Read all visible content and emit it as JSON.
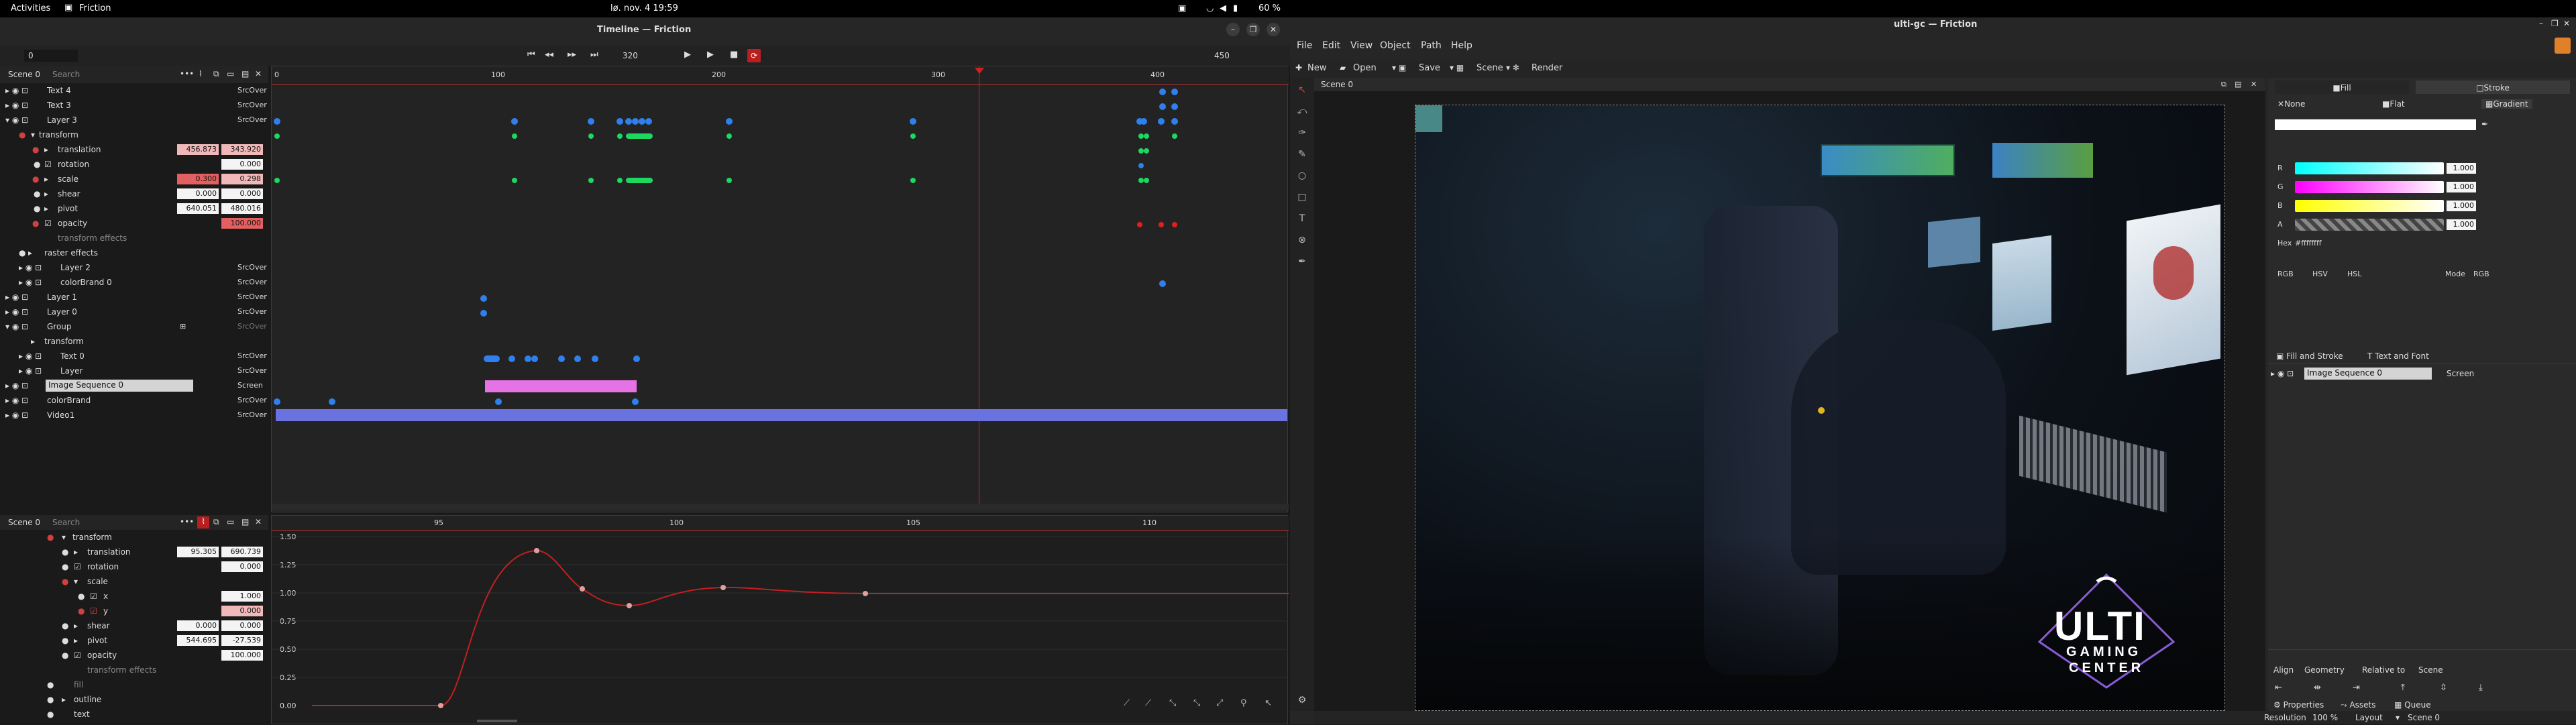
{
  "topbar": {
    "activities": "Activities",
    "app": "Friction",
    "clock": "lø. nov. 4  19:59",
    "battery": "60 %"
  },
  "timeline": {
    "title": "Timeline — Friction",
    "frame_start": "0",
    "frame_current": "320",
    "frame_end": "450",
    "scene": "Scene 0",
    "search_placeholder": "Search",
    "ruler": [
      "0",
      "100",
      "200",
      "300",
      "400"
    ],
    "layers": [
      {
        "name": "Text 4",
        "blend": "SrcOver"
      },
      {
        "name": "Text 3",
        "blend": "SrcOver"
      },
      {
        "name": "Layer 3",
        "blend": "SrcOver"
      },
      {
        "name": "transform"
      },
      {
        "name": "translation",
        "v1": "456.873",
        "v2": "343.920"
      },
      {
        "name": "rotation",
        "v1": "0.000"
      },
      {
        "name": "scale",
        "v1": "0.300",
        "v2": "0.298"
      },
      {
        "name": "shear",
        "v1": "0.000",
        "v2": "0.000"
      },
      {
        "name": "pivot",
        "v1": "640.051",
        "v2": "480.016"
      },
      {
        "name": "opacity",
        "v1": "100.000"
      },
      {
        "name": "transform effects"
      },
      {
        "name": "raster effects"
      },
      {
        "name": "Layer 2",
        "blend": "SrcOver"
      },
      {
        "name": "colorBrand 0",
        "blend": "SrcOver"
      },
      {
        "name": "Layer 1",
        "blend": "SrcOver"
      },
      {
        "name": "Layer 0",
        "blend": "SrcOver"
      },
      {
        "name": "Group",
        "blend": "SrcOver"
      },
      {
        "name": "transform"
      },
      {
        "name": "Text 0",
        "blend": "SrcOver"
      },
      {
        "name": "Layer",
        "blend": "SrcOver"
      },
      {
        "name": "Image Sequence 0",
        "blend": "Screen"
      },
      {
        "name": "colorBrand",
        "blend": "SrcOver"
      },
      {
        "name": "Video1",
        "blend": "SrcOver"
      }
    ]
  },
  "graph": {
    "scene": "Scene 0",
    "search_placeholder": "Search",
    "ruler": [
      "95",
      "100",
      "105",
      "110"
    ],
    "yticks": [
      "1.50",
      "1.25",
      "1.00",
      "0.75",
      "0.50",
      "0.25",
      "0.00"
    ],
    "props": [
      {
        "name": "transform"
      },
      {
        "name": "translation",
        "v1": "95.305",
        "v2": "690.739"
      },
      {
        "name": "rotation",
        "v1": "0.000"
      },
      {
        "name": "scale"
      },
      {
        "name": "x",
        "v1": "1.000"
      },
      {
        "name": "y",
        "v1": "0.000"
      },
      {
        "name": "shear",
        "v1": "0.000",
        "v2": "0.000"
      },
      {
        "name": "pivot",
        "v1": "544.695",
        "v2": "-27.539"
      },
      {
        "name": "opacity",
        "v1": "100.000"
      },
      {
        "name": "transform effects"
      },
      {
        "name": "fill"
      },
      {
        "name": "outline"
      },
      {
        "name": "text"
      }
    ]
  },
  "main": {
    "title": "ulti-gc — Friction",
    "menu": [
      "File",
      "Edit",
      "View",
      "Object",
      "Path",
      "Help"
    ],
    "toolbar": {
      "new": "New",
      "open": "Open",
      "save": "Save",
      "scene": "Scene",
      "render": "Render"
    },
    "scene_tab": "Scene 0",
    "logo": {
      "line1": "ULTI",
      "line2": "GAMING",
      "line3": "CENTER"
    },
    "status": {
      "resolution_label": "Resolution",
      "resolution": "100 %",
      "layout_label": "Layout",
      "layout": "Scene 0"
    }
  },
  "fill": {
    "fill_tab": "Fill",
    "stroke_tab": "Stroke",
    "none": "None",
    "flat": "Flat",
    "gradient": "Gradient",
    "channels": [
      {
        "label": "R",
        "value": "1.000"
      },
      {
        "label": "G",
        "value": "1.000"
      },
      {
        "label": "B",
        "value": "1.000"
      },
      {
        "label": "A",
        "value": "1.000"
      }
    ],
    "hex_label": "Hex",
    "hex": "#ffffffff",
    "modes": [
      "RGB",
      "HSV",
      "HSL"
    ],
    "mode_label": "Mode",
    "mode": "RGB",
    "fs_tab": "Fill and Stroke",
    "tf_tab": "Text and Font",
    "layer": "Image Sequence 0",
    "layer_blend": "Screen",
    "align": "Align",
    "geometry": "Geometry",
    "relative": "Relative to",
    "rel_value": "Scene",
    "bottom_tabs": [
      "Properties",
      "Assets",
      "Queue"
    ]
  },
  "colors": {
    "keyframe": "#2f80ed",
    "keyframe_green": "#1ed760",
    "keyframe_red": "#e02020",
    "playhead": "#d62020",
    "segment": "#e673e6",
    "video": "#6a72e0",
    "curve": "#c02020"
  }
}
